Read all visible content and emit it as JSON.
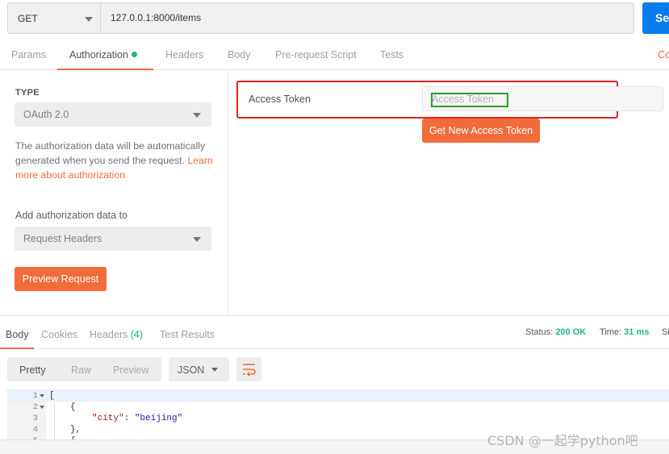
{
  "request": {
    "method": "GET",
    "url": "127.0.0.1:8000/items",
    "send_label": "Se"
  },
  "request_tabs": {
    "params": "Params",
    "authorization": "Authorization",
    "headers": "Headers",
    "body": "Body",
    "pre_request_script": "Pre-request Script",
    "tests": "Tests",
    "cookies": "Co"
  },
  "auth": {
    "type_label": "TYPE",
    "type_value": "OAuth 2.0",
    "description": "The authorization data will be automatically generated when you send the request.",
    "learn_more": "Learn more about authorization",
    "add_to_label": "Add authorization data to",
    "add_to_value": "Request Headers",
    "preview_button": "Preview Request",
    "access_token_label": "Access Token",
    "access_token_placeholder": "Access Token",
    "get_token_button": "Get New Access Token"
  },
  "response": {
    "tabs": {
      "body": "Body",
      "cookies": "Cookies",
      "headers": "Headers",
      "headers_count": "(4)",
      "test_results": "Test Results"
    },
    "status_label": "Status:",
    "status_value": "200 OK",
    "time_label": "Time:",
    "time_value": "31 ms",
    "size_label": "Si",
    "view_modes": [
      "Pretty",
      "Raw",
      "Preview"
    ],
    "format": "JSON",
    "code_lines": [
      {
        "num": "1",
        "text": "["
      },
      {
        "num": "2",
        "text": "{"
      },
      {
        "num": "3",
        "key": "\"city\"",
        "sep": ": ",
        "value": "\"beijing\""
      },
      {
        "num": "4",
        "text": "},"
      },
      {
        "num": "5",
        "text": "{"
      }
    ]
  },
  "watermark": "CSDN @一起学python吧",
  "colors": {
    "accent": "#f26b3a",
    "send_blue": "#097bed",
    "success_green": "#26b47f",
    "annotation_red": "#e32222",
    "annotation_green": "#23a023"
  }
}
